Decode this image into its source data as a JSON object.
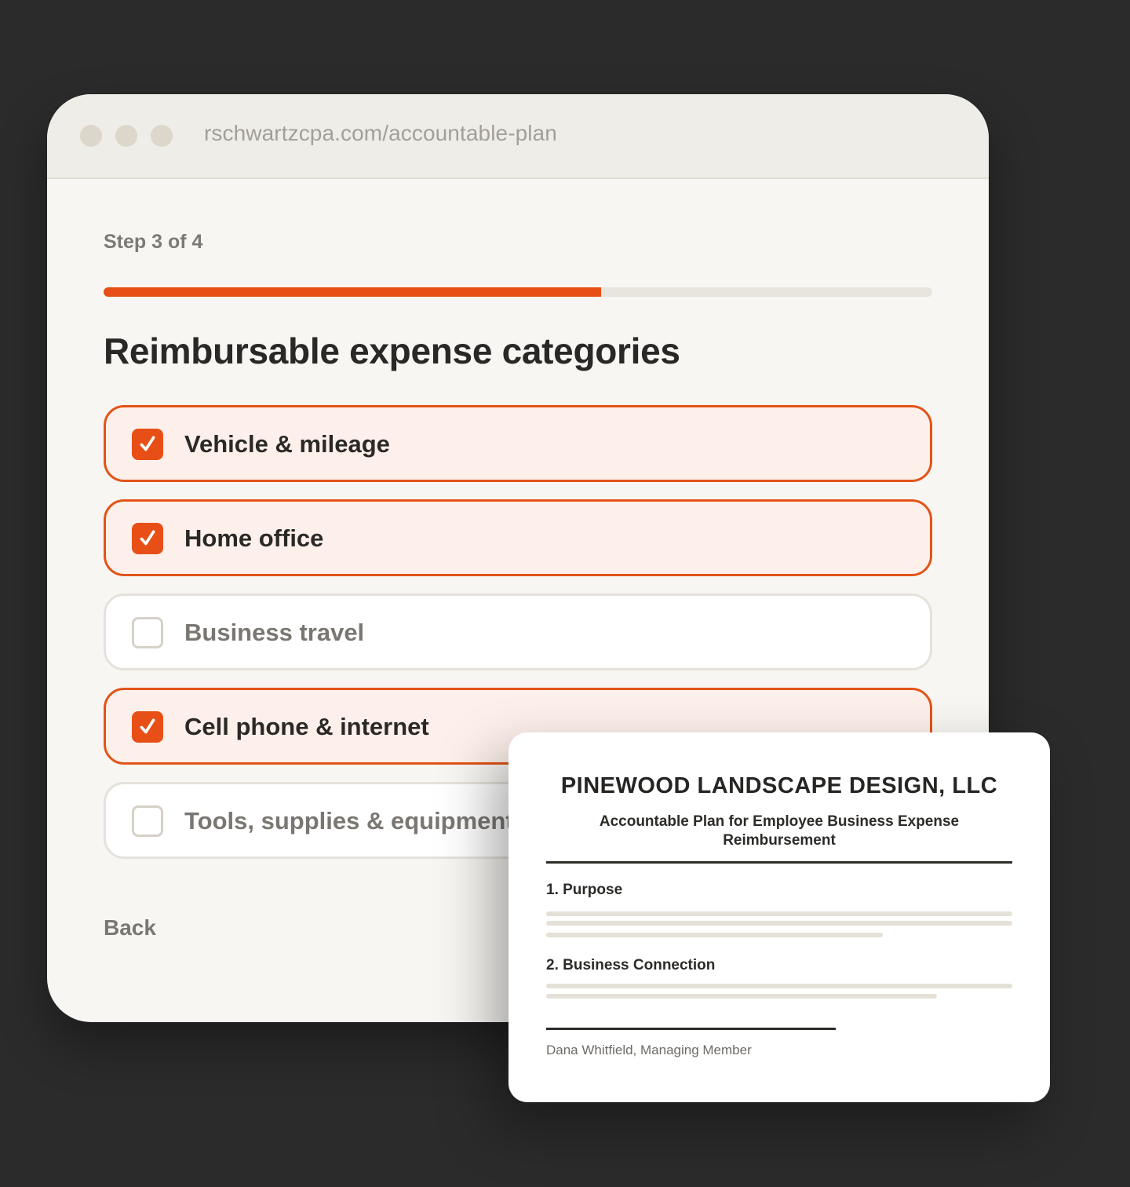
{
  "browser": {
    "url": "rschwartzcpa.com/accountable-plan"
  },
  "wizard": {
    "step_label": "Step 3 of 4",
    "progress_percent": 60,
    "accent_color": "#e84f16",
    "heading": "Reimbursable expense categories",
    "options": [
      {
        "label": "Vehicle & mileage",
        "checked": true
      },
      {
        "label": "Home office",
        "checked": true
      },
      {
        "label": "Business travel",
        "checked": false
      },
      {
        "label": "Cell phone & internet",
        "checked": true
      },
      {
        "label": "Tools, supplies & equipment",
        "checked": false
      }
    ],
    "back_label": "Back"
  },
  "document": {
    "company": "PINEWOOD LANDSCAPE DESIGN, LLC",
    "subtitle": "Accountable Plan for Employee Business Expense Reimbursement",
    "sections": [
      {
        "heading": "1. Purpose"
      },
      {
        "heading": "2. Business Connection"
      }
    ],
    "signer": "Dana Whitfield, Managing Member"
  }
}
